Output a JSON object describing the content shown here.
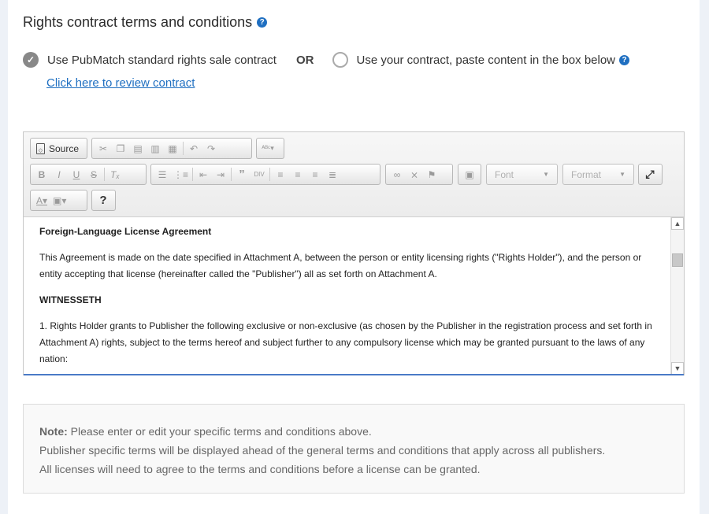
{
  "section": {
    "title": "Rights contract terms and conditions"
  },
  "options": {
    "standard_label": "Use PubMatch standard rights sale contract",
    "or_label": "OR",
    "custom_label": "Use your contract, paste content in the box below",
    "review_link": "Click here to review contract",
    "selected": "standard"
  },
  "editor": {
    "source_label": "Source",
    "font_placeholder": "Font",
    "format_placeholder": "Format",
    "help_label": "?",
    "icons": [
      "cut-icon",
      "copy-icon",
      "paste-icon",
      "paste-text-icon",
      "paste-word-icon",
      "undo-icon",
      "redo-icon",
      "spellcheck-icon",
      "bold-icon",
      "italic-icon",
      "underline-icon",
      "strike-icon",
      "remove-format-icon",
      "numbered-list-icon",
      "bulleted-list-icon",
      "outdent-icon",
      "indent-icon",
      "blockquote-icon",
      "div-icon",
      "align-left-icon",
      "align-center-icon",
      "align-right-icon",
      "justify-icon",
      "link-icon",
      "unlink-icon",
      "anchor-icon",
      "image-icon",
      "maximize-icon",
      "text-color-icon",
      "bg-color-icon"
    ],
    "content": {
      "heading": "Foreign-Language License Agreement",
      "para1": "This Agreement is made on the date specified in Attachment A, between the person or entity licensing rights (\"Rights Holder\"), and the person or entity accepting that license  (hereinafter called the \"Publisher\") all as set forth on Attachment A.",
      "subheading": "WITNESSETH",
      "para2": "1. Rights Holder grants to Publisher the following exclusive or non-exclusive (as chosen by the Publisher in the registration process and set forth in Attachment A) rights, subject to the terms hereof and subject further to any compulsory license which may be granted pursuant to the laws of any nation:"
    }
  },
  "note": {
    "label": "Note:",
    "line1": "Please enter or edit your specific terms and conditions above.",
    "line2": "Publisher specific terms will be displayed ahead of the general terms and conditions that apply across all publishers.",
    "line3": "All licenses will need to agree to the terms and conditions before a license can be granted."
  },
  "colors": {
    "accent": "#1f6fc1",
    "checked_radio": "#888888"
  }
}
